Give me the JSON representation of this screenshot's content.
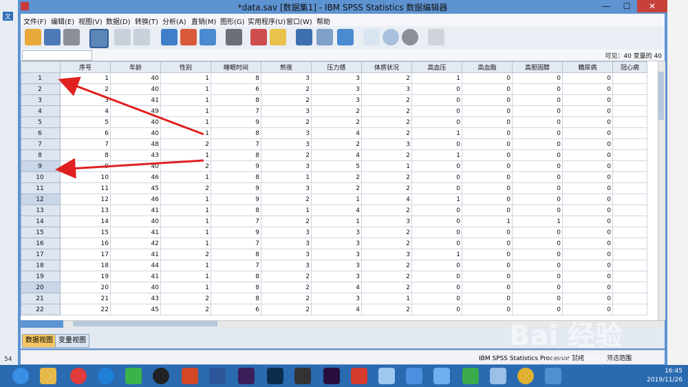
{
  "window": {
    "title": "*data.sav [数据集1] - IBM SPSS Statistics 数据编辑器"
  },
  "window_controls": {
    "minimize": "—",
    "maximize": "☐",
    "close": "✕"
  },
  "menu": [
    "文件(F)",
    "编辑(E)",
    "视图(V)",
    "数据(D)",
    "转换(T)",
    "分析(A)",
    "直销(M)",
    "图形(G)",
    "实用程序(U)",
    "窗口(W)",
    "帮助"
  ],
  "editrow": {
    "visible": "可见：40 变量的 40"
  },
  "columns": [
    "序号",
    "年龄",
    "性别",
    "睡眠时间",
    "熬夜",
    "压力感",
    "体质状况",
    "高血压",
    "高血脂",
    "高胆固醇",
    "糖尿病",
    "冠心病"
  ],
  "rows": [
    [
      "1",
      "1",
      "40",
      "1",
      "8",
      "3",
      "3",
      "2",
      "1",
      "0",
      "0",
      "0"
    ],
    [
      "2",
      "2",
      "40",
      "1",
      "6",
      "2",
      "3",
      "3",
      "0",
      "0",
      "0",
      "0"
    ],
    [
      "3",
      "3",
      "41",
      "1",
      "8",
      "2",
      "3",
      "2",
      "0",
      "0",
      "0",
      "0"
    ],
    [
      "4",
      "4",
      "49",
      "1",
      "7",
      "3",
      "2",
      "2",
      "0",
      "0",
      "0",
      "0"
    ],
    [
      "5",
      "5",
      "40",
      "1",
      "9",
      "2",
      "2",
      "2",
      "0",
      "0",
      "0",
      "0"
    ],
    [
      "6",
      "6",
      "40",
      "1",
      "8",
      "3",
      "4",
      "2",
      "1",
      "0",
      "0",
      "0"
    ],
    [
      "7",
      "7",
      "48",
      "2",
      "7",
      "3",
      "2",
      "3",
      "0",
      "0",
      "0",
      "0"
    ],
    [
      "8",
      "8",
      "43",
      "1",
      "8",
      "2",
      "4",
      "2",
      "1",
      "0",
      "0",
      "0"
    ],
    [
      "9",
      "9",
      "40",
      "2",
      "9",
      "3",
      "5",
      "1",
      "0",
      "0",
      "0",
      "0"
    ],
    [
      "10",
      "10",
      "46",
      "1",
      "8",
      "1",
      "2",
      "2",
      "0",
      "0",
      "0",
      "0"
    ],
    [
      "11",
      "11",
      "45",
      "2",
      "9",
      "3",
      "2",
      "2",
      "0",
      "0",
      "0",
      "0"
    ],
    [
      "12",
      "12",
      "46",
      "1",
      "9",
      "2",
      "1",
      "4",
      "1",
      "0",
      "0",
      "0"
    ],
    [
      "13",
      "13",
      "41",
      "1",
      "8",
      "1",
      "4",
      "2",
      "0",
      "0",
      "0",
      "0"
    ],
    [
      "14",
      "14",
      "40",
      "1",
      "7",
      "2",
      "1",
      "3",
      "0",
      "1",
      "1",
      "0"
    ],
    [
      "15",
      "15",
      "41",
      "1",
      "9",
      "3",
      "3",
      "2",
      "0",
      "0",
      "0",
      "0"
    ],
    [
      "16",
      "16",
      "42",
      "1",
      "7",
      "3",
      "3",
      "2",
      "0",
      "0",
      "0",
      "0"
    ],
    [
      "17",
      "17",
      "41",
      "2",
      "8",
      "3",
      "3",
      "3",
      "1",
      "0",
      "0",
      "0"
    ],
    [
      "18",
      "18",
      "44",
      "1",
      "7",
      "3",
      "3",
      "2",
      "0",
      "0",
      "0",
      "0"
    ],
    [
      "19",
      "19",
      "41",
      "1",
      "8",
      "2",
      "3",
      "2",
      "0",
      "0",
      "0",
      "0"
    ],
    [
      "20",
      "20",
      "40",
      "1",
      "8",
      "2",
      "4",
      "2",
      "0",
      "0",
      "0",
      "0"
    ],
    [
      "21",
      "21",
      "43",
      "2",
      "8",
      "2",
      "3",
      "1",
      "0",
      "0",
      "0",
      "0"
    ],
    [
      "22",
      "22",
      "45",
      "2",
      "6",
      "2",
      "4",
      "2",
      "0",
      "0",
      "0",
      "0"
    ]
  ],
  "selected_rows": [
    "9",
    "12",
    "20"
  ],
  "tabs": {
    "data_view": "数据视图",
    "variable_view": "变量视图"
  },
  "status": {
    "processor": "IBM SPSS Statistics Processor 就绪",
    "filter": "筛选范围"
  },
  "clock": {
    "time": "16:45",
    "date": "2019/11/26"
  },
  "watermark": {
    "brand": "Bai 经验",
    "url": "jingyan.baidu.com"
  },
  "colors": {
    "accent": "#5e93d1",
    "tab_active": "#f7c863",
    "arrow": "#e02020",
    "close": "#c7413a"
  },
  "background_fragments": [
    "文",
    "54"
  ]
}
